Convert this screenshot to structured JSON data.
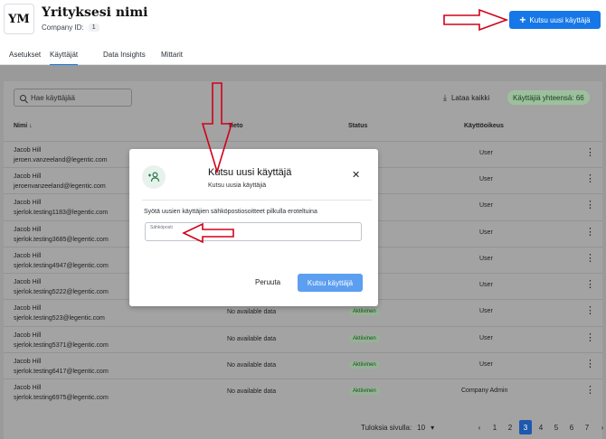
{
  "header": {
    "logo_text": "YM",
    "company_name": "Yrityksesi nimi",
    "company_id_label": "Company ID:",
    "company_id_value": "1",
    "invite_button_label": "Kutsu uusi käyttäjä"
  },
  "tabs": [
    {
      "label": "Asetukset",
      "active": false
    },
    {
      "label": "Käyttäjät",
      "active": true
    },
    {
      "label": "Data Insights",
      "active": false
    },
    {
      "label": "Mittarit",
      "active": false
    }
  ],
  "toolbar": {
    "search_placeholder": "Hae käyttäjää",
    "download_label": "Lataa kaikki",
    "user_count": "Käyttäjiä yhteensä: 66"
  },
  "table": {
    "columns": [
      "Nimi ↓",
      "Tieto",
      "Status",
      "Käyttöoikeus"
    ],
    "rows": [
      {
        "name": "Jacob Hill",
        "email": "jeroen.vanzeeland@legentic.com",
        "data": "",
        "status": "",
        "role": "User"
      },
      {
        "name": "Jacob Hill",
        "email": "jeroenvanzeeland@legentic.com",
        "data": "",
        "status": "",
        "role": "User"
      },
      {
        "name": "Jacob Hill",
        "email": "sjerlok.testing1183@legentic.com",
        "data": "",
        "status": "",
        "role": "User"
      },
      {
        "name": "Jacob Hill",
        "email": "sjerlok.testing3685@legentic.com",
        "data": "",
        "status": "",
        "role": "User"
      },
      {
        "name": "Jacob Hill",
        "email": "sjerlok.testing4947@legentic.com",
        "data": "",
        "status": "",
        "role": "User"
      },
      {
        "name": "Jacob Hill",
        "email": "sjerlok.testing5222@legentic.com",
        "data": "",
        "status": "",
        "role": "User"
      },
      {
        "name": "Jacob Hill",
        "email": "sjerlok.testing523@legentic.com",
        "data": "No available data",
        "status": "Aktiivinen",
        "role": "User"
      },
      {
        "name": "Jacob Hill",
        "email": "sjerlok.testing5371@legentic.com",
        "data": "No available data",
        "status": "Aktiivinen",
        "role": "User"
      },
      {
        "name": "Jacob Hill",
        "email": "sjerlok.testing6417@legentic.com",
        "data": "No available data",
        "status": "Aktiivinen",
        "role": "User"
      },
      {
        "name": "Jacob Hill",
        "email": "sjerlok.testing6975@legentic.com",
        "data": "No available data",
        "status": "Aktiivinen",
        "role": "Company Admin"
      }
    ]
  },
  "pagination": {
    "rows_per_page_label": "Tuloksia sivulla:",
    "rows_per_page_value": "10",
    "prev": "‹",
    "next": "›",
    "pages": [
      "1",
      "2",
      "3",
      "4",
      "5",
      "6",
      "7"
    ],
    "current_page": "3"
  },
  "modal": {
    "title": "Kutsu uusi käyttäjä",
    "subtitle": "Kutsu uusia käyttäjiä",
    "instructions": "Syötä uusien käyttäjien sähköpostiosoitteet pilkulla eroteltuina",
    "input_label": "Sähköposti",
    "cancel_label": "Peruuta",
    "submit_label": "Kutsu käyttäjä"
  },
  "colors": {
    "primary": "#1677e8",
    "annotation_arrow": "#d0021b",
    "active_badge": "#93b393"
  }
}
